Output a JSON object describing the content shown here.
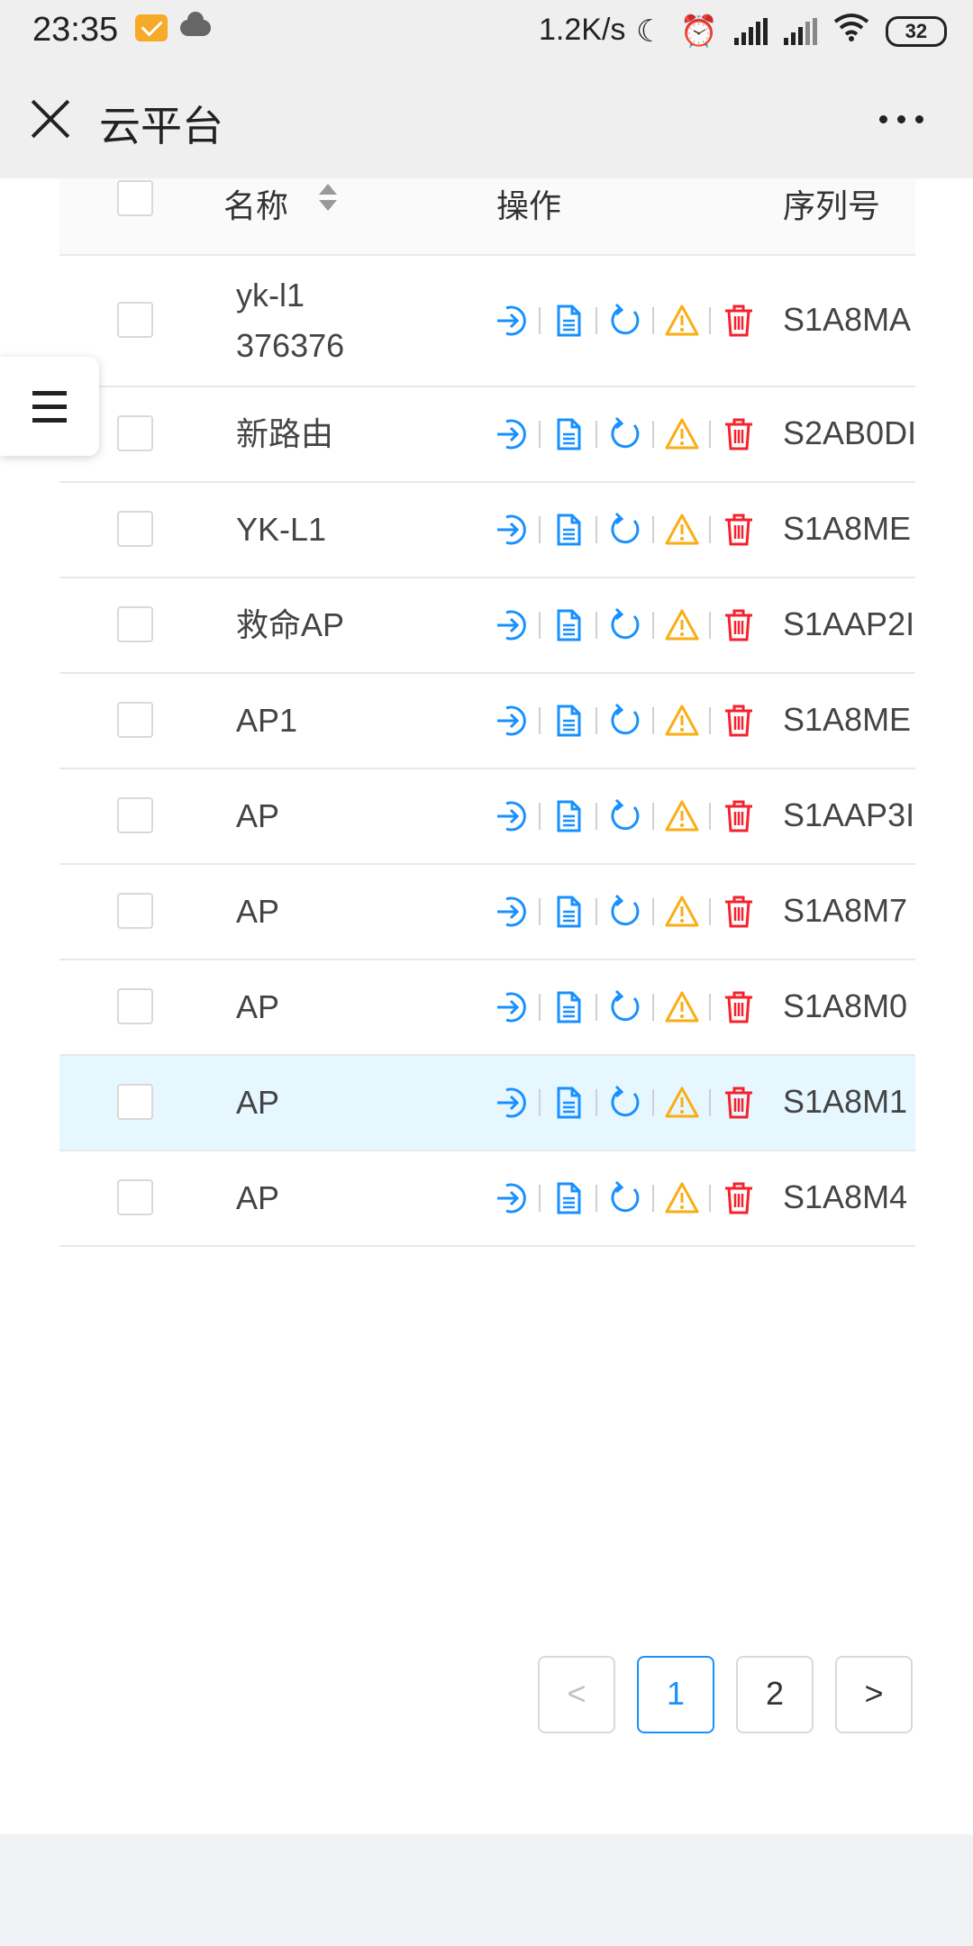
{
  "status_bar": {
    "time": "23:35",
    "net_speed": "1.2K/s",
    "battery": "32",
    "icons": [
      "mail-icon",
      "cloud-icon",
      "moon-icon",
      "alarm-icon",
      "signal-icon",
      "signal-icon",
      "wifi-icon",
      "battery-icon"
    ]
  },
  "title_bar": {
    "title": "云平台",
    "close_icon": "close-icon",
    "more_icon": "more-icon"
  },
  "table": {
    "headers": {
      "name": "名称",
      "action": "操作",
      "serial": "序列号"
    },
    "rows": [
      {
        "name": "yk-l1\n376376",
        "serial": "S1A8MA",
        "highlight": false
      },
      {
        "name": "新路由",
        "serial": "S2AB0DI",
        "highlight": false
      },
      {
        "name": "YK-L1",
        "serial": "S1A8ME",
        "highlight": false
      },
      {
        "name": "救命AP",
        "serial": "S1AAP2I",
        "highlight": false
      },
      {
        "name": "AP1",
        "serial": "S1A8ME",
        "highlight": false
      },
      {
        "name": "AP",
        "serial": "S1AAP3I",
        "highlight": false
      },
      {
        "name": "AP",
        "serial": "S1A8M7",
        "highlight": false
      },
      {
        "name": "AP",
        "serial": "S1A8M0",
        "highlight": false
      },
      {
        "name": "AP",
        "serial": "S1A8M1",
        "highlight": true
      },
      {
        "name": "AP",
        "serial": "S1A8M4",
        "highlight": false
      }
    ],
    "action_icons": [
      "login-icon",
      "document-icon",
      "refresh-icon",
      "warning-icon",
      "delete-icon"
    ]
  },
  "pagination": {
    "prev": "<",
    "pages": [
      "1",
      "2"
    ],
    "current": "1",
    "next": ">"
  },
  "colors": {
    "primary": "#1890ff",
    "warning": "#faad14",
    "danger": "#f5222d",
    "highlight_row": "#e6f7ff"
  }
}
